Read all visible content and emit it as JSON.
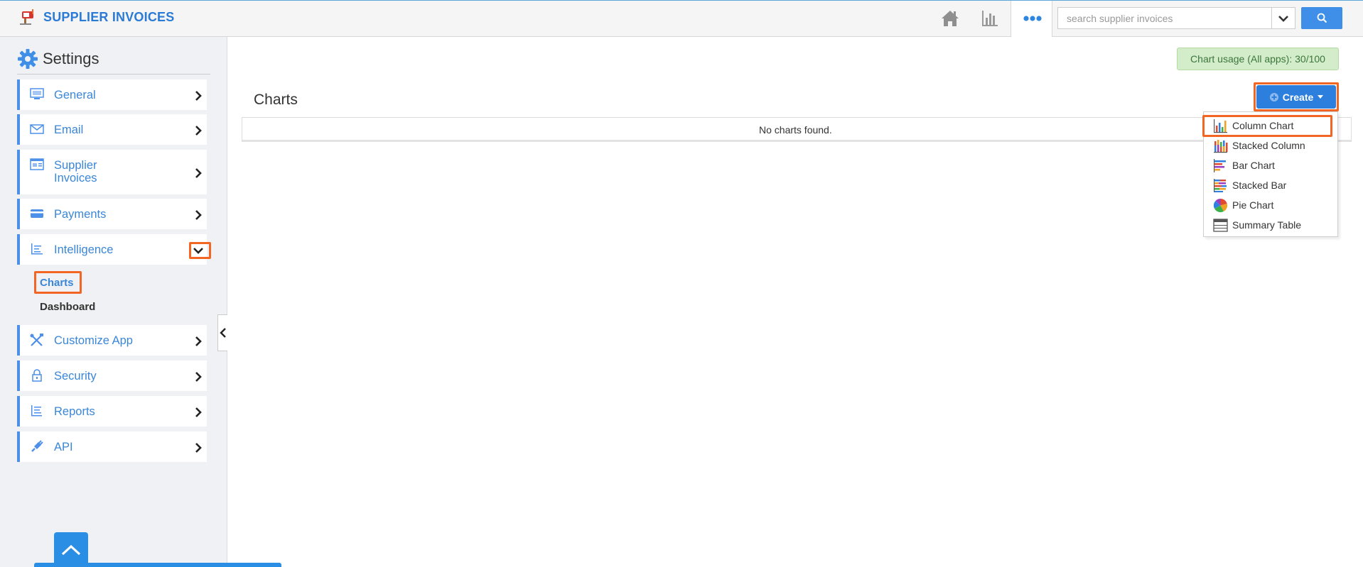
{
  "app": {
    "title": "SUPPLIER INVOICES",
    "logo_icon": "mailbox-icon"
  },
  "topbar": {
    "icons": [
      "home-icon",
      "bar-chart-icon",
      "more-dots-icon"
    ],
    "search": {
      "placeholder": "search supplier invoices",
      "value": ""
    },
    "search_button_icon": "search-icon"
  },
  "sidebar": {
    "title": "Settings",
    "title_icon": "gear-icon",
    "items": [
      {
        "label": "General",
        "icon": "monitor-icon"
      },
      {
        "label": "Email",
        "icon": "envelope-icon"
      },
      {
        "label": "Supplier Invoices",
        "icon": "invoice-icon"
      },
      {
        "label": "Payments",
        "icon": "credit-card-icon"
      },
      {
        "label": "Intelligence",
        "icon": "report-lines-icon",
        "expanded": true
      },
      {
        "label": "Customize App",
        "icon": "tools-icon"
      },
      {
        "label": "Security",
        "icon": "lock-icon"
      },
      {
        "label": "Reports",
        "icon": "list-icon"
      },
      {
        "label": "API",
        "icon": "plug-icon"
      }
    ],
    "sub_items": [
      {
        "label": "Charts",
        "active": true
      },
      {
        "label": "Dashboard",
        "active": false
      }
    ]
  },
  "main": {
    "usage_badge": "Chart usage (All apps): 30/100",
    "page_title": "Charts",
    "create_button": "Create",
    "empty_message": "No charts found.",
    "create_menu": [
      {
        "label": "Column Chart",
        "icon": "column-chart-icon",
        "highlighted": true
      },
      {
        "label": "Stacked Column",
        "icon": "stacked-column-icon"
      },
      {
        "label": "Bar Chart",
        "icon": "bar-chart-icon"
      },
      {
        "label": "Stacked Bar",
        "icon": "stacked-bar-icon"
      },
      {
        "label": "Pie Chart",
        "icon": "pie-chart-icon"
      },
      {
        "label": "Summary Table",
        "icon": "table-icon"
      }
    ]
  },
  "colors": {
    "accent": "#3a86d8",
    "highlight": "#f26522",
    "button": "#2d7fde",
    "badge_bg": "#d3ecc9"
  }
}
